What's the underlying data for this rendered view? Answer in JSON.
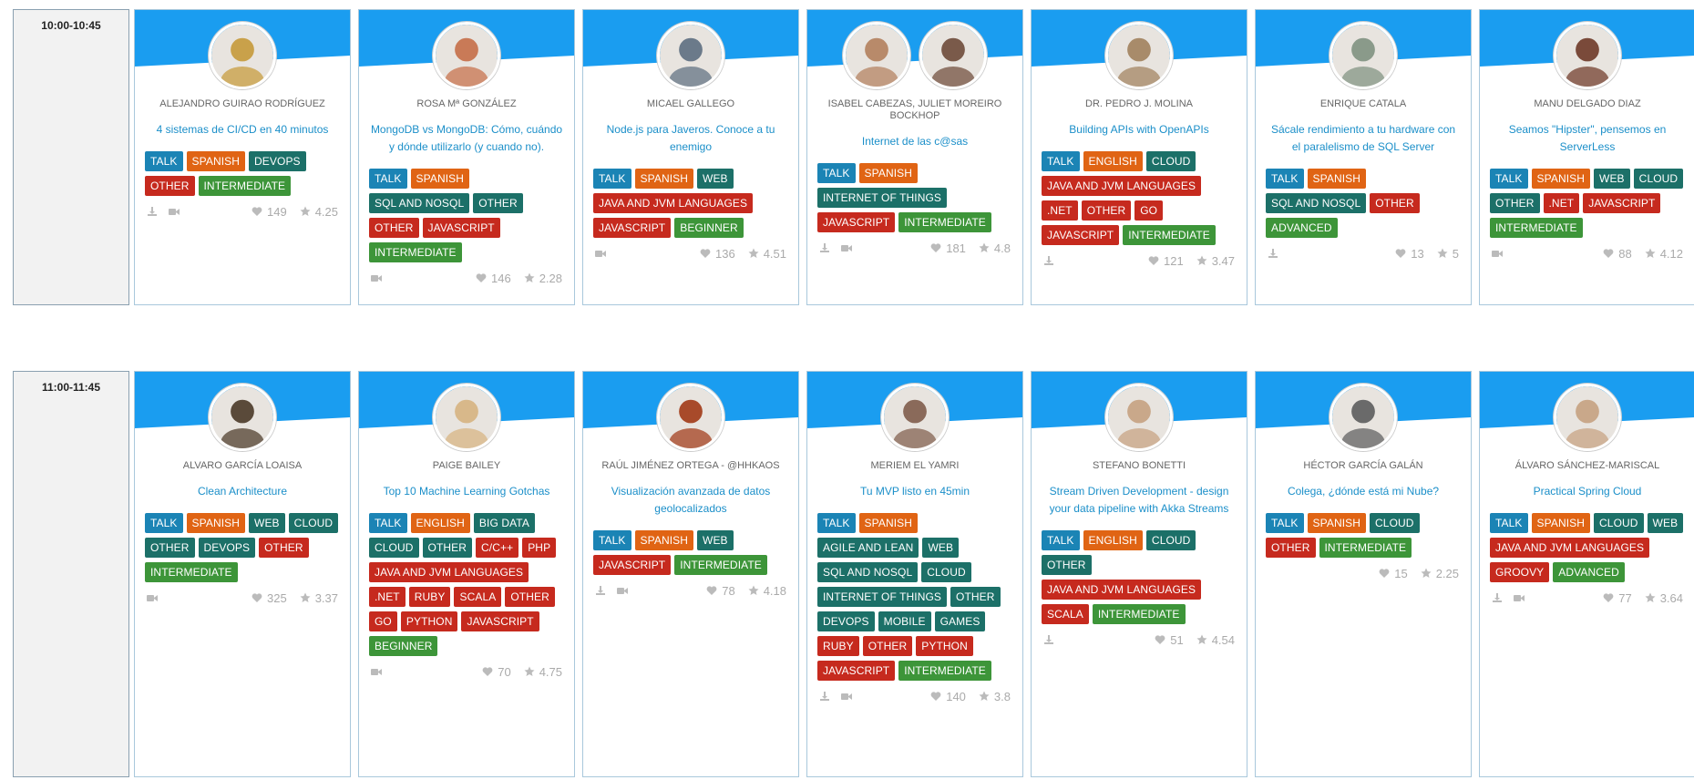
{
  "colors": {
    "banner_blue": "#1a9df0",
    "format_tag": "#1b84b5",
    "language_tag": "#e06414",
    "topic_tag": "#1c7068",
    "other_tag": "#c62a1e",
    "level_tag": "#3d9539",
    "title_link": "#1b8fc9"
  },
  "slots": [
    {
      "time": "10:00-10:45",
      "cards": [
        {
          "speaker": "ALEJANDRO GUIRAO RODRÍGUEZ",
          "title": "4 sistemas de CI/CD en 40 minutos",
          "avatars": [
            "#c9a14a"
          ],
          "tags": [
            {
              "label": "TALK",
              "kind": "format"
            },
            {
              "label": "SPANISH",
              "kind": "lang"
            },
            {
              "label": "DEVOPS",
              "kind": "topic"
            },
            {
              "label": "OTHER",
              "kind": "other"
            },
            {
              "label": "INTERMEDIATE",
              "kind": "level"
            }
          ],
          "download": true,
          "video": true,
          "likes": "149",
          "rating": "4.25"
        },
        {
          "speaker": "ROSA Mª GONZÁLEZ",
          "title": "MongoDB vs MongoDB: Cómo, cuándo y dónde utilizarlo (y cuando no).",
          "avatars": [
            "#c97a57"
          ],
          "tags": [
            {
              "label": "TALK",
              "kind": "format"
            },
            {
              "label": "SPANISH",
              "kind": "lang"
            },
            {
              "label": "SQL AND NOSQL",
              "kind": "topic"
            },
            {
              "label": "OTHER",
              "kind": "topic"
            },
            {
              "label": "OTHER",
              "kind": "other"
            },
            {
              "label": "JAVASCRIPT",
              "kind": "other"
            },
            {
              "label": "INTERMEDIATE",
              "kind": "level"
            }
          ],
          "download": false,
          "video": true,
          "likes": "146",
          "rating": "2.28"
        },
        {
          "speaker": "MICAEL GALLEGO",
          "title": "Node.js para Javeros. Conoce a tu enemigo",
          "avatars": [
            "#6b7a8a"
          ],
          "tags": [
            {
              "label": "TALK",
              "kind": "format"
            },
            {
              "label": "SPANISH",
              "kind": "lang"
            },
            {
              "label": "WEB",
              "kind": "topic"
            },
            {
              "label": "JAVA AND JVM LANGUAGES",
              "kind": "other"
            },
            {
              "label": "JAVASCRIPT",
              "kind": "other"
            },
            {
              "label": "BEGINNER",
              "kind": "level"
            }
          ],
          "download": false,
          "video": true,
          "likes": "136",
          "rating": "4.51"
        },
        {
          "speaker": "ISABEL CABEZAS, JULIET MOREIRO BOCKHOP",
          "title": "Internet de las c@sas",
          "avatars": [
            "#b88a6a",
            "#7a5a4a"
          ],
          "tags": [
            {
              "label": "TALK",
              "kind": "format"
            },
            {
              "label": "SPANISH",
              "kind": "lang"
            },
            {
              "label": "INTERNET OF THINGS",
              "kind": "topic"
            },
            {
              "label": "JAVASCRIPT",
              "kind": "other"
            },
            {
              "label": "INTERMEDIATE",
              "kind": "level"
            }
          ],
          "download": true,
          "video": true,
          "likes": "181",
          "rating": "4.8"
        },
        {
          "speaker": "DR. PEDRO J. MOLINA",
          "title": "Building APIs with OpenAPIs",
          "avatars": [
            "#a88b6a"
          ],
          "tags": [
            {
              "label": "TALK",
              "kind": "format"
            },
            {
              "label": "ENGLISH",
              "kind": "lang"
            },
            {
              "label": "CLOUD",
              "kind": "topic"
            },
            {
              "label": "JAVA AND JVM LANGUAGES",
              "kind": "other"
            },
            {
              "label": ".NET",
              "kind": "other"
            },
            {
              "label": "OTHER",
              "kind": "other"
            },
            {
              "label": "GO",
              "kind": "other"
            },
            {
              "label": "JAVASCRIPT",
              "kind": "other"
            },
            {
              "label": "INTERMEDIATE",
              "kind": "level"
            }
          ],
          "download": true,
          "video": false,
          "likes": "121",
          "rating": "3.47"
        },
        {
          "speaker": "ENRIQUE CATALA",
          "title": "Sácale rendimiento a tu hardware con el paralelismo de SQL Server",
          "avatars": [
            "#8a9a8a"
          ],
          "tags": [
            {
              "label": "TALK",
              "kind": "format"
            },
            {
              "label": "SPANISH",
              "kind": "lang"
            },
            {
              "label": "SQL AND NOSQL",
              "kind": "topic"
            },
            {
              "label": "OTHER",
              "kind": "other"
            },
            {
              "label": "ADVANCED",
              "kind": "level"
            }
          ],
          "download": true,
          "video": false,
          "likes": "13",
          "rating": "5"
        },
        {
          "speaker": "MANU DELGADO DIAZ",
          "title": "Seamos \"Hipster\", pensemos en ServerLess",
          "avatars": [
            "#7a4a3a"
          ],
          "tags": [
            {
              "label": "TALK",
              "kind": "format"
            },
            {
              "label": "SPANISH",
              "kind": "lang"
            },
            {
              "label": "WEB",
              "kind": "topic"
            },
            {
              "label": "CLOUD",
              "kind": "topic"
            },
            {
              "label": "OTHER",
              "kind": "topic"
            },
            {
              "label": ".NET",
              "kind": "other"
            },
            {
              "label": "JAVASCRIPT",
              "kind": "other"
            },
            {
              "label": "INTERMEDIATE",
              "kind": "level"
            }
          ],
          "download": false,
          "video": true,
          "likes": "88",
          "rating": "4.12"
        }
      ]
    },
    {
      "time": "11:00-11:45",
      "cards": [
        {
          "speaker": "ALVARO GARCÍA LOAISA",
          "title": "Clean Architecture",
          "avatars": [
            "#5a4a3a"
          ],
          "tags": [
            {
              "label": "TALK",
              "kind": "format"
            },
            {
              "label": "SPANISH",
              "kind": "lang"
            },
            {
              "label": "WEB",
              "kind": "topic"
            },
            {
              "label": "CLOUD",
              "kind": "topic"
            },
            {
              "label": "OTHER",
              "kind": "topic"
            },
            {
              "label": "DEVOPS",
              "kind": "topic"
            },
            {
              "label": "OTHER",
              "kind": "other"
            },
            {
              "label": "INTERMEDIATE",
              "kind": "level"
            }
          ],
          "download": false,
          "video": true,
          "likes": "325",
          "rating": "3.37"
        },
        {
          "speaker": "PAIGE BAILEY",
          "title": "Top 10 Machine Learning Gotchas",
          "avatars": [
            "#d8b88a"
          ],
          "tags": [
            {
              "label": "TALK",
              "kind": "format"
            },
            {
              "label": "ENGLISH",
              "kind": "lang"
            },
            {
              "label": "BIG DATA",
              "kind": "topic"
            },
            {
              "label": "CLOUD",
              "kind": "topic"
            },
            {
              "label": "OTHER",
              "kind": "topic"
            },
            {
              "label": "C/C++",
              "kind": "other"
            },
            {
              "label": "PHP",
              "kind": "other"
            },
            {
              "label": "JAVA AND JVM LANGUAGES",
              "kind": "other"
            },
            {
              "label": ".NET",
              "kind": "other"
            },
            {
              "label": "RUBY",
              "kind": "other"
            },
            {
              "label": "SCALA",
              "kind": "other"
            },
            {
              "label": "OTHER",
              "kind": "other"
            },
            {
              "label": "GO",
              "kind": "other"
            },
            {
              "label": "PYTHON",
              "kind": "other"
            },
            {
              "label": "JAVASCRIPT",
              "kind": "other"
            },
            {
              "label": "BEGINNER",
              "kind": "level"
            }
          ],
          "download": false,
          "video": true,
          "likes": "70",
          "rating": "4.75"
        },
        {
          "speaker": "RAÚL JIMÉNEZ ORTEGA - @HHKAOS",
          "title": "Visualización avanzada de datos geolocalizados",
          "avatars": [
            "#a84a2a"
          ],
          "tags": [
            {
              "label": "TALK",
              "kind": "format"
            },
            {
              "label": "SPANISH",
              "kind": "lang"
            },
            {
              "label": "WEB",
              "kind": "topic"
            },
            {
              "label": "JAVASCRIPT",
              "kind": "other"
            },
            {
              "label": "INTERMEDIATE",
              "kind": "level"
            }
          ],
          "download": true,
          "video": true,
          "likes": "78",
          "rating": "4.18"
        },
        {
          "speaker": "MERIEM EL YAMRI",
          "title": "Tu MVP listo en 45min",
          "avatars": [
            "#8a6a5a"
          ],
          "tags": [
            {
              "label": "TALK",
              "kind": "format"
            },
            {
              "label": "SPANISH",
              "kind": "lang"
            },
            {
              "label": "AGILE AND LEAN",
              "kind": "topic"
            },
            {
              "label": "WEB",
              "kind": "topic"
            },
            {
              "label": "SQL AND NOSQL",
              "kind": "topic"
            },
            {
              "label": "CLOUD",
              "kind": "topic"
            },
            {
              "label": "INTERNET OF THINGS",
              "kind": "topic"
            },
            {
              "label": "OTHER",
              "kind": "topic"
            },
            {
              "label": "DEVOPS",
              "kind": "topic"
            },
            {
              "label": "MOBILE",
              "kind": "topic"
            },
            {
              "label": "GAMES",
              "kind": "topic"
            },
            {
              "label": "RUBY",
              "kind": "other"
            },
            {
              "label": "OTHER",
              "kind": "other"
            },
            {
              "label": "PYTHON",
              "kind": "other"
            },
            {
              "label": "JAVASCRIPT",
              "kind": "other"
            },
            {
              "label": "INTERMEDIATE",
              "kind": "level"
            }
          ],
          "download": true,
          "video": true,
          "likes": "140",
          "rating": "3.8"
        },
        {
          "speaker": "STEFANO BONETTI",
          "title": "Stream Driven Development - design your data pipeline with Akka Streams",
          "avatars": [
            "#c9a88a"
          ],
          "tags": [
            {
              "label": "TALK",
              "kind": "format"
            },
            {
              "label": "ENGLISH",
              "kind": "lang"
            },
            {
              "label": "CLOUD",
              "kind": "topic"
            },
            {
              "label": "OTHER",
              "kind": "topic"
            },
            {
              "label": "JAVA AND JVM LANGUAGES",
              "kind": "other"
            },
            {
              "label": "SCALA",
              "kind": "other"
            },
            {
              "label": "INTERMEDIATE",
              "kind": "level"
            }
          ],
          "download": true,
          "video": false,
          "likes": "51",
          "rating": "4.54"
        },
        {
          "speaker": "HÉCTOR GARCÍA GALÁN",
          "title": "Colega, ¿dónde está mi Nube?",
          "avatars": [
            "#6a6a6a"
          ],
          "tags": [
            {
              "label": "TALK",
              "kind": "format"
            },
            {
              "label": "SPANISH",
              "kind": "lang"
            },
            {
              "label": "CLOUD",
              "kind": "topic"
            },
            {
              "label": "OTHER",
              "kind": "other"
            },
            {
              "label": "INTERMEDIATE",
              "kind": "level"
            }
          ],
          "download": false,
          "video": false,
          "likes": "15",
          "rating": "2.25"
        },
        {
          "speaker": "ÁLVARO SÁNCHEZ-MARISCAL",
          "title": "Practical Spring Cloud",
          "avatars": [
            "#c9a88a"
          ],
          "tags": [
            {
              "label": "TALK",
              "kind": "format"
            },
            {
              "label": "SPANISH",
              "kind": "lang"
            },
            {
              "label": "CLOUD",
              "kind": "topic"
            },
            {
              "label": "WEB",
              "kind": "topic"
            },
            {
              "label": "JAVA AND JVM LANGUAGES",
              "kind": "other"
            },
            {
              "label": "GROOVY",
              "kind": "other"
            },
            {
              "label": "ADVANCED",
              "kind": "level"
            }
          ],
          "download": true,
          "video": true,
          "likes": "77",
          "rating": "3.64"
        }
      ]
    }
  ]
}
